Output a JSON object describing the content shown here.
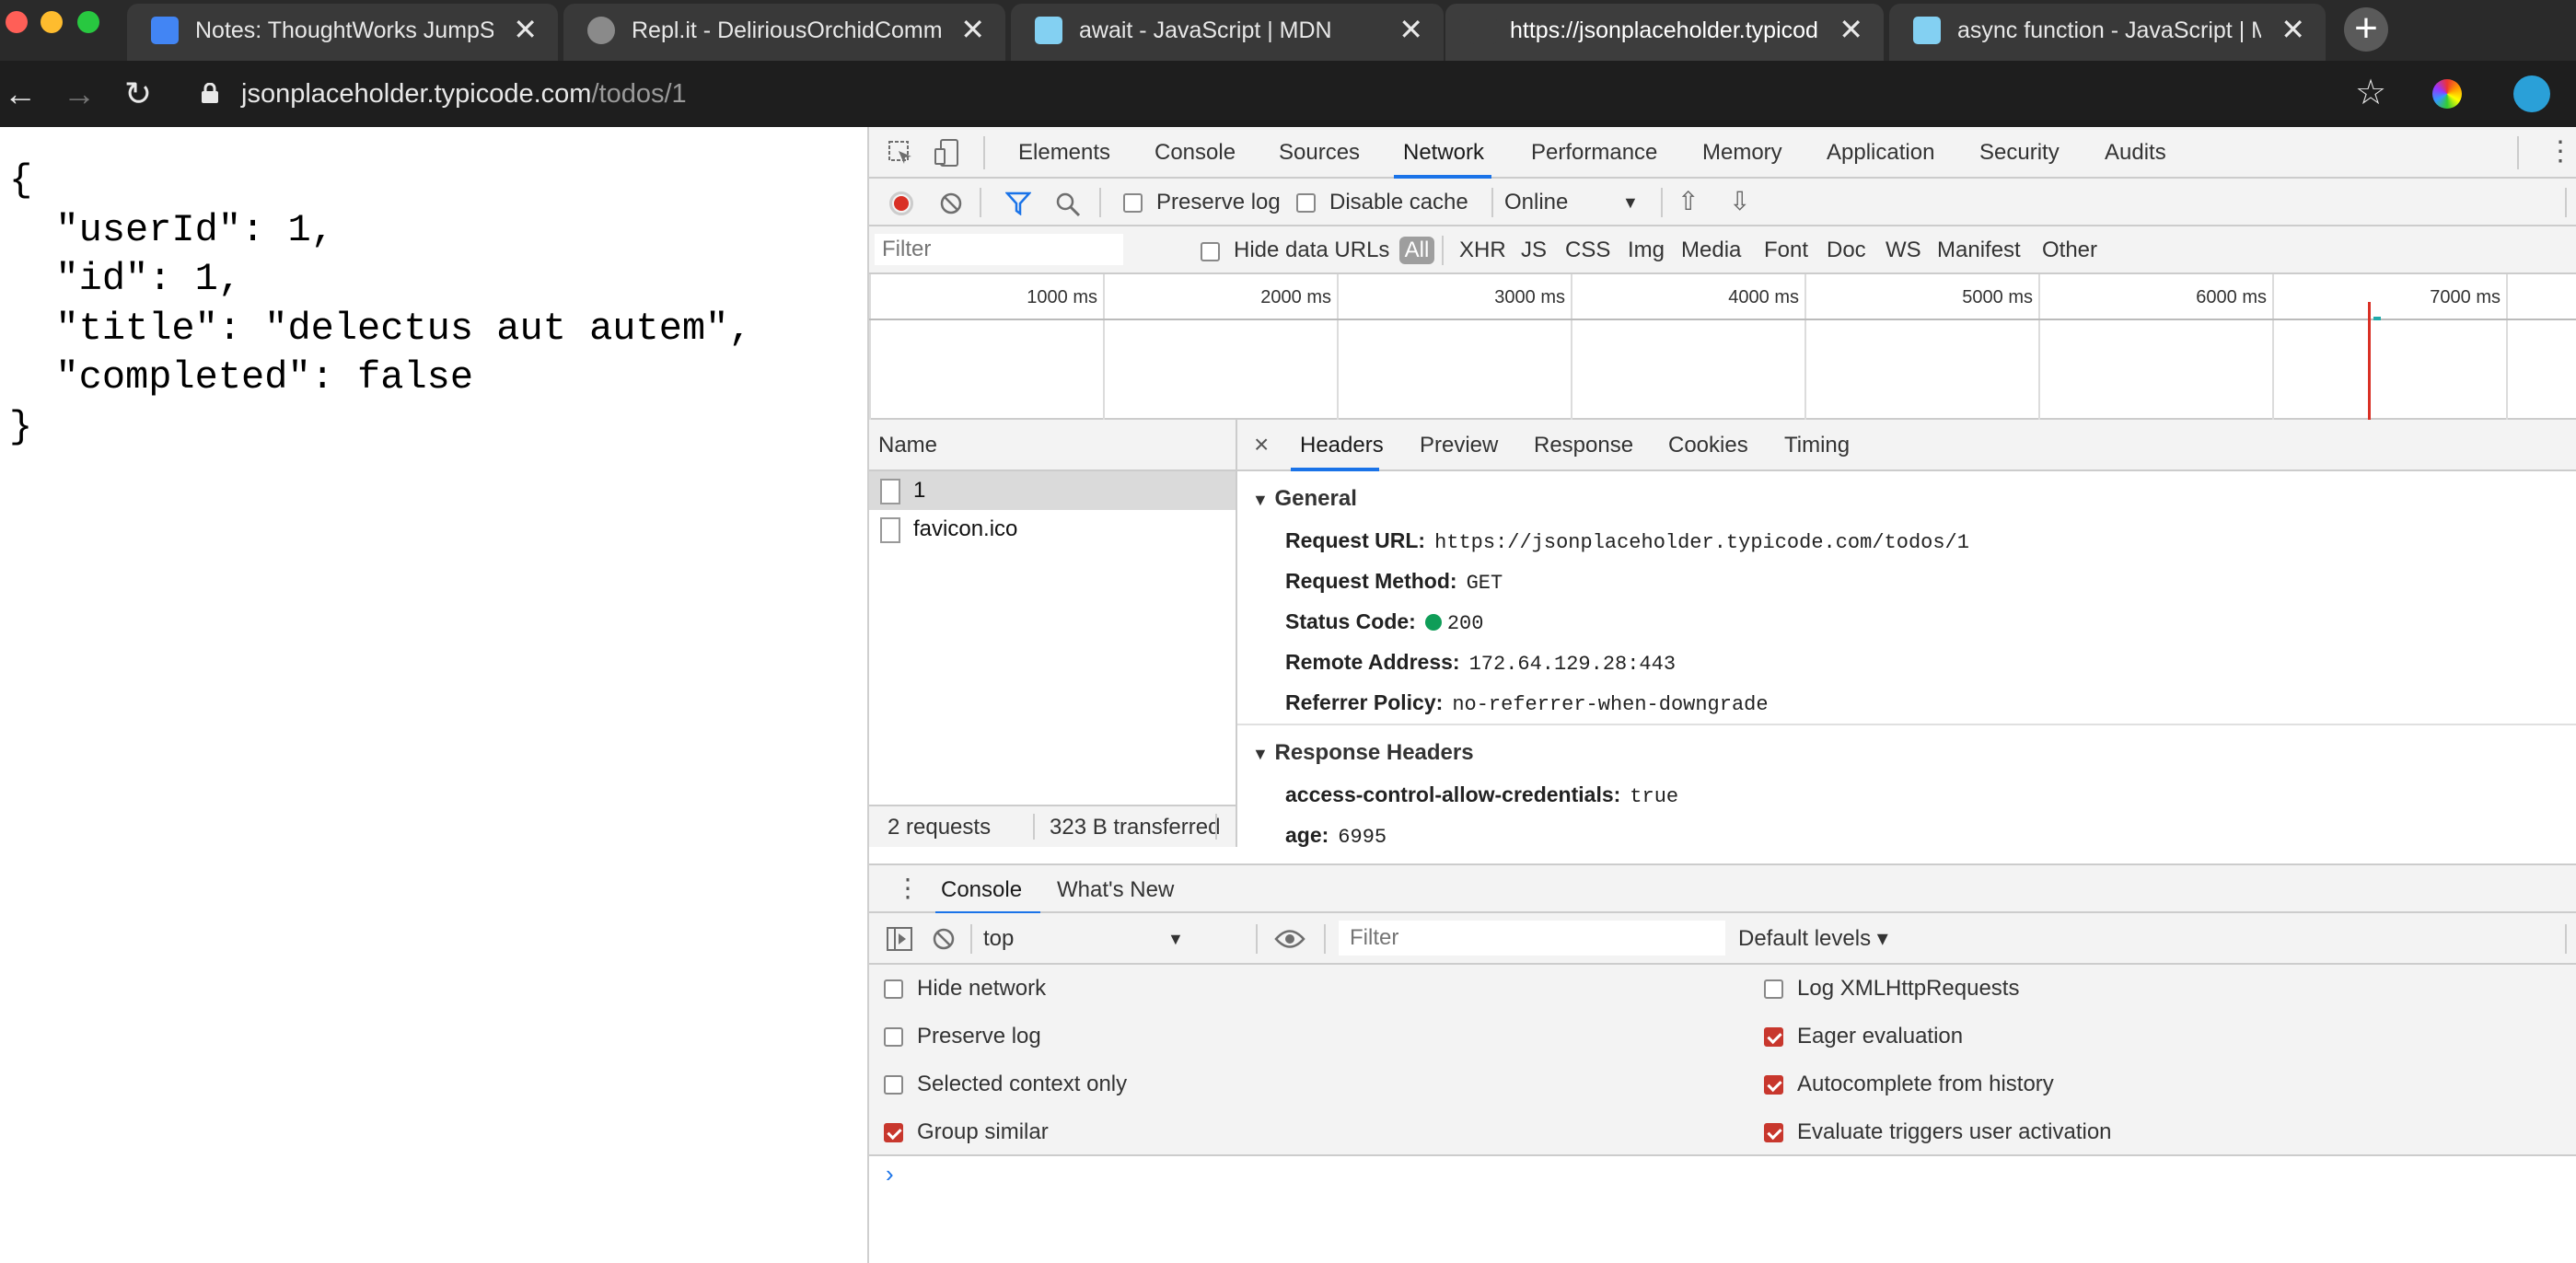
{
  "browser": {
    "tabs": [
      {
        "title": "Notes: ThoughtWorks JumpSta",
        "favicon_color": "#4285f4"
      },
      {
        "title": "Repl.it - DeliriousOrchidComm",
        "favicon_color": "#8a8a8a"
      },
      {
        "title": "await - JavaScript | MDN",
        "favicon_color": "#83d0f2"
      },
      {
        "title": "https://jsonplaceholder.typicod",
        "favicon_color": "#3d3d3d"
      },
      {
        "title": "async function - JavaScript | M",
        "favicon_color": "#83d0f2"
      }
    ],
    "close_glyph": "✕",
    "url_host": "jsonplaceholder.typicode.com",
    "url_path": "/todos/1"
  },
  "page": {
    "json_text": "{\n  \"userId\": 1,\n  \"id\": 1,\n  \"title\": \"delectus aut autem\",\n  \"completed\": false\n}"
  },
  "devtools": {
    "panel_tabs": [
      "Elements",
      "Console",
      "Sources",
      "Network",
      "Performance",
      "Memory",
      "Application",
      "Security",
      "Audits"
    ],
    "active_panel": "Network",
    "network_toolbar": {
      "preserve_log": "Preserve log",
      "disable_cache": "Disable cache",
      "throttling": "Online"
    },
    "filter": {
      "placeholder": "Filter",
      "hide_data_urls": "Hide data URLs",
      "types": [
        "All",
        "XHR",
        "JS",
        "CSS",
        "Img",
        "Media",
        "Font",
        "Doc",
        "WS",
        "Manifest",
        "Other"
      ]
    },
    "timeline_ticks": [
      "1000 ms",
      "2000 ms",
      "3000 ms",
      "4000 ms",
      "5000 ms",
      "6000 ms",
      "7000 ms"
    ],
    "request_list": {
      "header": "Name",
      "rows": [
        "1",
        "favicon.ico"
      ],
      "summary_requests": "2 requests",
      "summary_transferred": "323 B transferred"
    },
    "details": {
      "close_glyph": "×",
      "tabs": [
        "Headers",
        "Preview",
        "Response",
        "Cookies",
        "Timing"
      ],
      "general_title": "General",
      "general": [
        {
          "key": "Request URL:",
          "value": "https://jsonplaceholder.typicode.com/todos/1"
        },
        {
          "key": "Request Method:",
          "value": "GET"
        },
        {
          "key": "Status Code:",
          "value": "200"
        },
        {
          "key": "Remote Address:",
          "value": "172.64.129.28:443"
        },
        {
          "key": "Referrer Policy:",
          "value": "no-referrer-when-downgrade"
        }
      ],
      "response_title": "Response Headers",
      "response": [
        {
          "key": "access-control-allow-credentials:",
          "value": "true"
        },
        {
          "key": "age:",
          "value": "6995"
        }
      ]
    },
    "drawer": {
      "tabs": [
        "Console",
        "What's New"
      ],
      "context": "top",
      "filter_placeholder": "Filter",
      "levels": "Default levels ▾",
      "settings_left": [
        {
          "label": "Hide network",
          "checked": false
        },
        {
          "label": "Preserve log",
          "checked": false
        },
        {
          "label": "Selected context only",
          "checked": false
        },
        {
          "label": "Group similar",
          "checked": true
        }
      ],
      "settings_right": [
        {
          "label": "Log XMLHttpRequests",
          "checked": false
        },
        {
          "label": "Eager evaluation",
          "checked": true
        },
        {
          "label": "Autocomplete from history",
          "checked": true
        },
        {
          "label": "Evaluate triggers user activation",
          "checked": true
        }
      ],
      "prompt": "›"
    }
  }
}
